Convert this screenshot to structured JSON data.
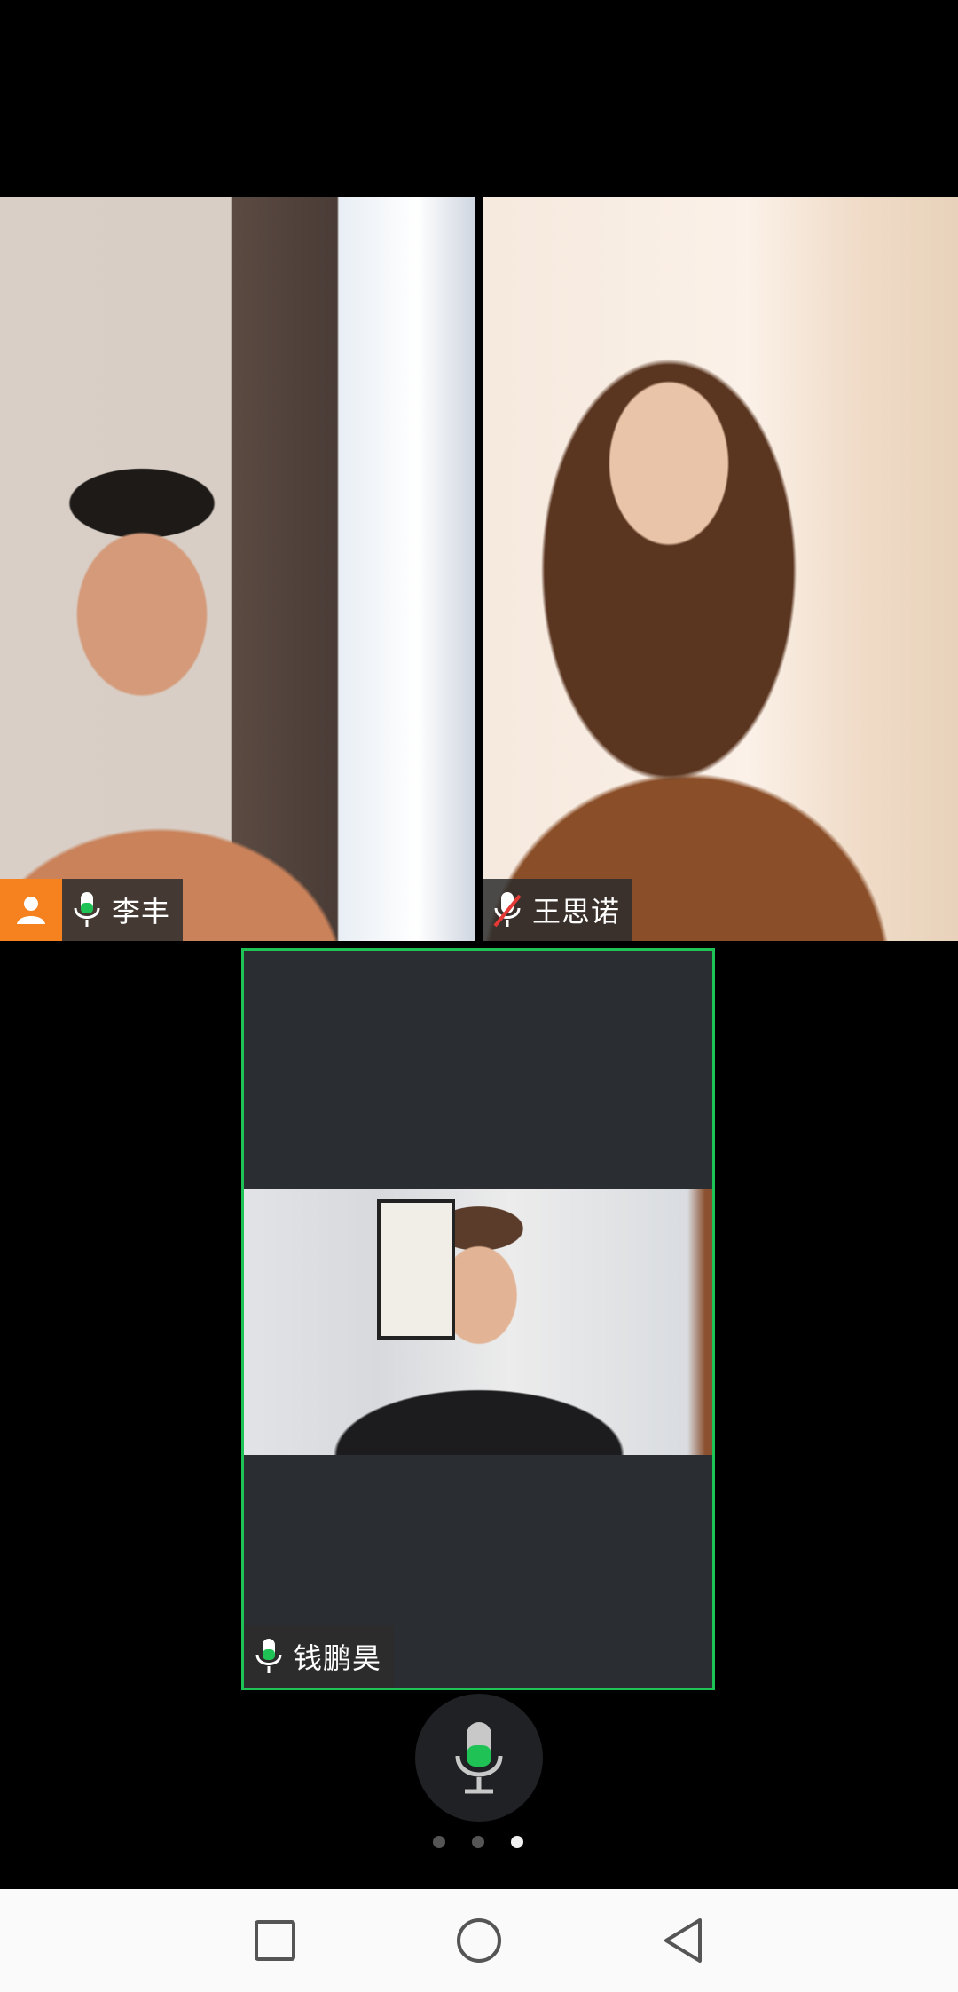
{
  "participants": [
    {
      "name": "李丰",
      "mic": "on",
      "host": true
    },
    {
      "name": "王思诺",
      "mic": "muted",
      "host": false
    },
    {
      "name": "钱鹏昊",
      "mic": "on",
      "host": false,
      "active_speaker": true
    }
  ],
  "controls": {
    "mic_state": "on"
  },
  "pager": {
    "total": 3,
    "current": 3
  },
  "nav": {
    "buttons": [
      "recents-square-icon",
      "home-circle-icon",
      "back-triangle-icon"
    ]
  },
  "colors": {
    "active_border": "#1fc254",
    "mic_green": "#1fc254",
    "host_badge": "#f5821f",
    "muted_red": "#e53935"
  }
}
